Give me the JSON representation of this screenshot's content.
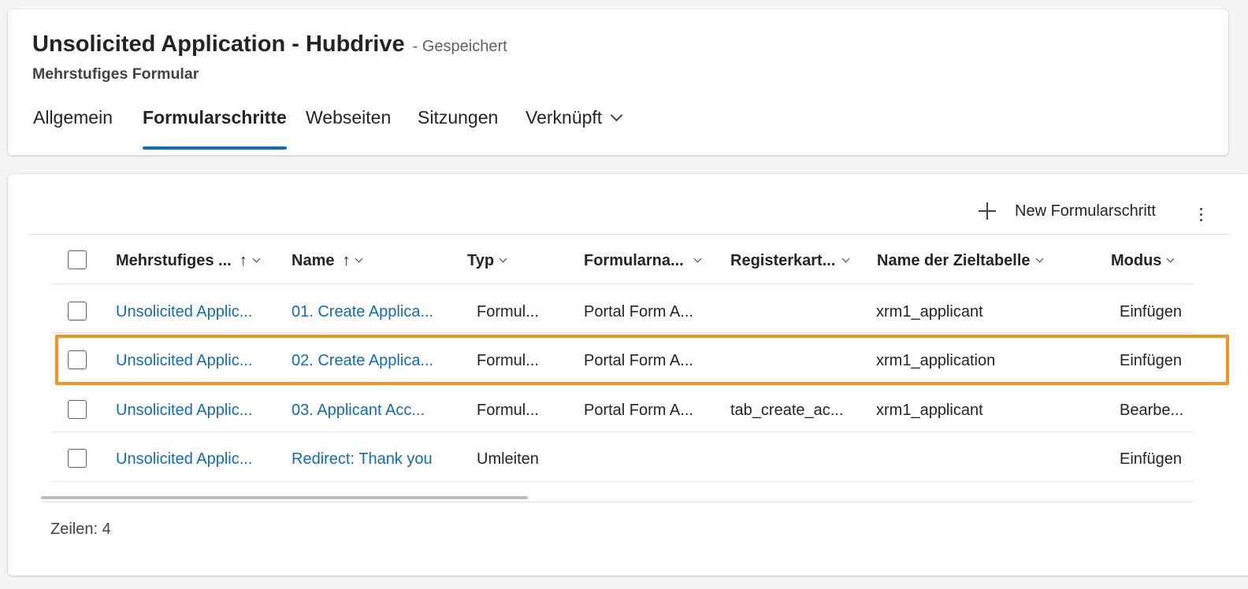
{
  "header": {
    "title": "Unsolicited Application - Hubdrive",
    "save_status": "- Gespeichert",
    "subtitle": "Mehrstufiges Formular",
    "tabs": [
      {
        "label": "Allgemein",
        "selected": false
      },
      {
        "label": "Formularschritte",
        "selected": true
      },
      {
        "label": "Webseiten",
        "selected": false
      },
      {
        "label": "Sitzungen",
        "selected": false
      },
      {
        "label": "Verknüpft",
        "selected": false
      }
    ]
  },
  "commands": {
    "new_label": "New Formularschritt",
    "more_icon": "more-vertical-icon"
  },
  "grid": {
    "columns": [
      {
        "label": "Mehrstufiges ...",
        "sort": "↑"
      },
      {
        "label": "Name",
        "sort": "↑"
      },
      {
        "label": "Typ",
        "sort": ""
      },
      {
        "label": "Formularna...",
        "sort": ""
      },
      {
        "label": "Registerkart...",
        "sort": ""
      },
      {
        "label": "Name der Zieltabelle",
        "sort": ""
      },
      {
        "label": "Modus",
        "sort": ""
      }
    ],
    "rows": [
      {
        "form": "Unsolicited Applic...",
        "name": "01. Create Applica...",
        "type": "Formul...",
        "formname": "Portal Form A...",
        "tab": "",
        "table": "xrm1_applicant",
        "mode": "Einfügen"
      },
      {
        "form": "Unsolicited Applic...",
        "name": "02. Create Applica...",
        "type": "Formul...",
        "formname": "Portal Form A...",
        "tab": "",
        "table": "xrm1_application",
        "mode": "Einfügen"
      },
      {
        "form": "Unsolicited Applic...",
        "name": "03. Applicant Acc...",
        "type": "Formul...",
        "formname": "Portal Form A...",
        "tab": "tab_create_ac...",
        "table": "xrm1_applicant",
        "mode": "Bearbe..."
      },
      {
        "form": "Unsolicited Applic...",
        "name": "Redirect: Thank you",
        "type": "Umleiten",
        "formname": "",
        "tab": "",
        "table": "",
        "mode": "Einfügen"
      }
    ],
    "highlighted_row": 1,
    "highlight_color": "#f7941d",
    "link_color": "#0f6cbd",
    "row_count_label": "Zeilen: 4"
  }
}
